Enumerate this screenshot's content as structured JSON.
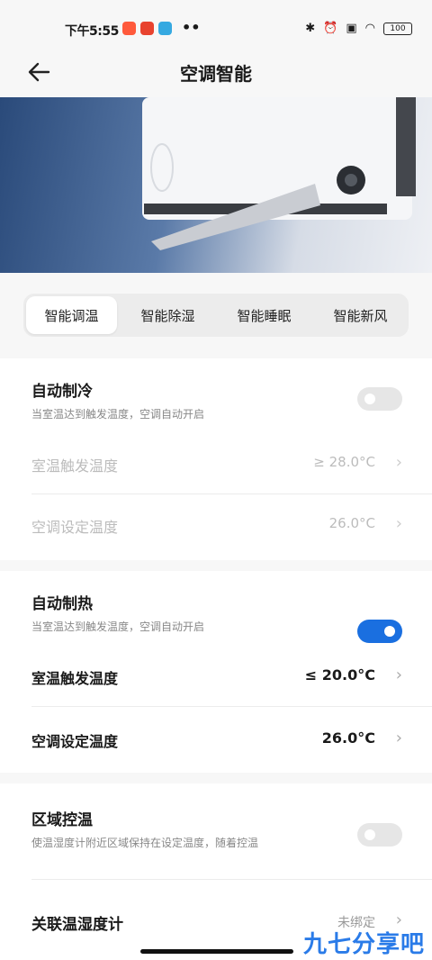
{
  "status_bar": {
    "time": "下午5:55",
    "dots": "••",
    "battery": "100"
  },
  "header": {
    "title": "空调智能"
  },
  "tabs": [
    {
      "label": "智能调温",
      "active": true
    },
    {
      "label": "智能除湿",
      "active": false
    },
    {
      "label": "智能睡眠",
      "active": false
    },
    {
      "label": "智能新风",
      "active": false
    }
  ],
  "auto_cool": {
    "title": "自动制冷",
    "subtitle": "当室温达到触发温度，空调自动开启",
    "enabled": false,
    "trigger_label": "室温触发温度",
    "trigger_value": "≥ 28.0°C",
    "set_label": "空调设定温度",
    "set_value": "26.0°C"
  },
  "auto_heat": {
    "title": "自动制热",
    "subtitle": "当室温达到触发温度，空调自动开启",
    "enabled": true,
    "trigger_label": "室温触发温度",
    "trigger_value": "≤ 20.0°C",
    "set_label": "空调设定温度",
    "set_value": "26.0°C"
  },
  "zone": {
    "title": "区域控温",
    "subtitle": "使温湿度计附近区域保持在设定温度，随着控温",
    "enabled": false
  },
  "linked": {
    "title": "关联温湿度计",
    "value": "未绑定"
  },
  "watermark": "九七分享吧",
  "colors": {
    "accent": "#1a6fe0"
  }
}
